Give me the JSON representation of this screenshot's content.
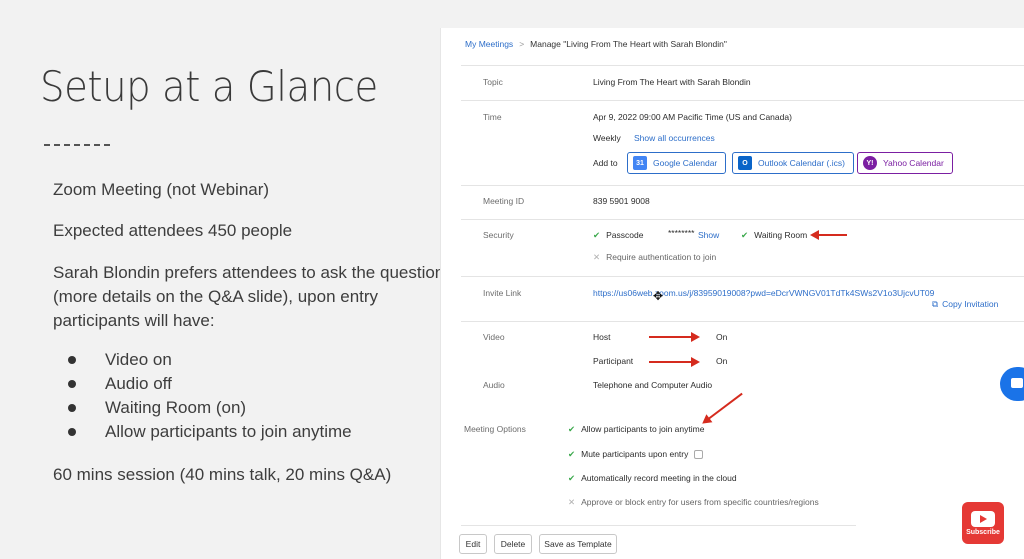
{
  "slide": {
    "title": "Setup at a Glance",
    "lines": [
      "Zoom Meeting (not Webinar)",
      "Expected attendees 450 people",
      "Sarah Blondin prefers attendees to ask the questions",
      "(more details on the Q&A slide), upon entry",
      "participants will have:"
    ],
    "bullets": [
      "Video on",
      "Audio off",
      "Waiting Room (on)",
      "Allow participants to join anytime"
    ],
    "footer": "60 mins session (40 mins talk, 20 mins Q&A)"
  },
  "zoom": {
    "breadcrumb": {
      "link": "My Meetings",
      "current": "Manage \"Living From The Heart with Sarah Blondin\""
    },
    "topic": {
      "label": "Topic",
      "value": "Living From The Heart with Sarah Blondin"
    },
    "time": {
      "label": "Time",
      "value": "Apr 9, 2022 09:00 AM Pacific Time (US and Canada)",
      "recurrence": "Weekly",
      "show_all": "Show all occurrences",
      "add_to": "Add to",
      "google": "Google Calendar",
      "outlook": "Outlook Calendar (.ics)",
      "yahoo": "Yahoo Calendar"
    },
    "meeting_id": {
      "label": "Meeting ID",
      "value": "839 5901 9008"
    },
    "security": {
      "label": "Security",
      "passcode": "Passcode",
      "masked": "********",
      "show": "Show",
      "waiting_room": "Waiting Room",
      "require_auth": "Require authentication to join"
    },
    "invite": {
      "label": "Invite Link",
      "url": "https://us06web.zoom.us/j/83959019008?pwd=eDcrVWNGV01TdTk4SWs2V1o3UjcvUT09",
      "copy": "Copy Invitation"
    },
    "video": {
      "label": "Video",
      "host": "Host",
      "host_value": "On",
      "participant": "Participant",
      "participant_value": "On"
    },
    "audio": {
      "label": "Audio",
      "value": "Telephone and Computer Audio"
    },
    "options": {
      "label": "Meeting Options",
      "items": [
        "Allow participants to join anytime",
        "Mute participants upon entry",
        "Automatically record meeting in the cloud",
        "Approve or block entry for users from specific countries/regions"
      ]
    },
    "buttons": {
      "edit": "Edit",
      "delete": "Delete",
      "save_template": "Save as Template"
    }
  },
  "subscribe": "Subscribe",
  "colors": {
    "zoom_blue": "#2d6ec9",
    "arrow_red": "#d52b1e",
    "check_green": "#3aa84b",
    "youtube_red": "#e53935"
  }
}
